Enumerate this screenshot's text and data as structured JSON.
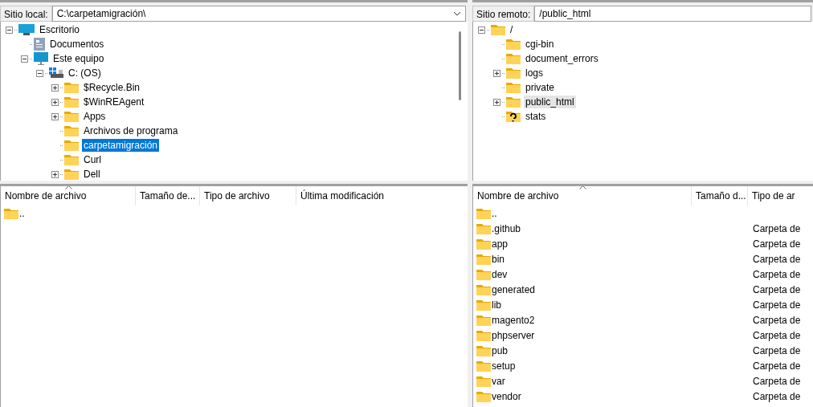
{
  "local": {
    "label": "Sitio local:",
    "path": "C:\\carpetamigración\\",
    "focused": true,
    "tree": [
      {
        "name": "Escritorio",
        "kind": "desktop",
        "expanded": true,
        "selected": false,
        "children": [
          {
            "name": "Documentos",
            "kind": "document",
            "selected": false
          },
          {
            "name": "Este equipo",
            "kind": "computer",
            "expanded": true,
            "selected": false,
            "children": [
              {
                "name": "C: (OS)",
                "kind": "drive",
                "expanded": true,
                "selected": false,
                "children": [
                  {
                    "name": "$Recycle.Bin",
                    "kind": "folder",
                    "expanded": false,
                    "selected": false
                  },
                  {
                    "name": "$WinREAgent",
                    "kind": "folder",
                    "expanded": false,
                    "selected": false
                  },
                  {
                    "name": "Apps",
                    "kind": "folder",
                    "expanded": false,
                    "selected": false
                  },
                  {
                    "name": "Archivos de programa",
                    "kind": "folder",
                    "selected": false
                  },
                  {
                    "name": "carpetamigración",
                    "kind": "folder",
                    "selected": true
                  },
                  {
                    "name": "Curl",
                    "kind": "folder",
                    "selected": false
                  },
                  {
                    "name": "Dell",
                    "kind": "folder",
                    "expanded": false,
                    "selected": false
                  }
                ]
              }
            ]
          }
        ]
      }
    ],
    "columns": [
      "Nombre de archivo",
      "Tamaño de...",
      "Tipo de archivo",
      "Última modificación"
    ],
    "rows": [
      {
        "name": ".."
      }
    ]
  },
  "remote": {
    "label": "Sitio remoto:",
    "path": "/public_html",
    "focused": false,
    "tree": [
      {
        "name": "/",
        "kind": "folder",
        "expanded": true,
        "selected": false,
        "children": [
          {
            "name": "cgi-bin",
            "kind": "folder",
            "selected": false
          },
          {
            "name": "document_errors",
            "kind": "folder",
            "selected": false
          },
          {
            "name": "logs",
            "kind": "folder",
            "expanded": false,
            "selected": false
          },
          {
            "name": "private",
            "kind": "folder",
            "selected": false
          },
          {
            "name": "public_html",
            "kind": "folder",
            "expanded": false,
            "selected": true
          },
          {
            "name": "stats",
            "kind": "unknown",
            "selected": false
          }
        ]
      }
    ],
    "columns": [
      "Nombre de archivo",
      "Tamaño d...",
      "Tipo de ar"
    ],
    "rows": [
      {
        "name": ".."
      },
      {
        "name": ".github",
        "type": "Carpeta de"
      },
      {
        "name": "app",
        "type": "Carpeta de"
      },
      {
        "name": "bin",
        "type": "Carpeta de"
      },
      {
        "name": "dev",
        "type": "Carpeta de"
      },
      {
        "name": "generated",
        "type": "Carpeta de"
      },
      {
        "name": "lib",
        "type": "Carpeta de"
      },
      {
        "name": "magento2",
        "type": "Carpeta de"
      },
      {
        "name": "phpserver",
        "type": "Carpeta de"
      },
      {
        "name": "pub",
        "type": "Carpeta de"
      },
      {
        "name": "setup",
        "type": "Carpeta de"
      },
      {
        "name": "var",
        "type": "Carpeta de"
      },
      {
        "name": "vendor",
        "type": "Carpeta de"
      }
    ]
  }
}
